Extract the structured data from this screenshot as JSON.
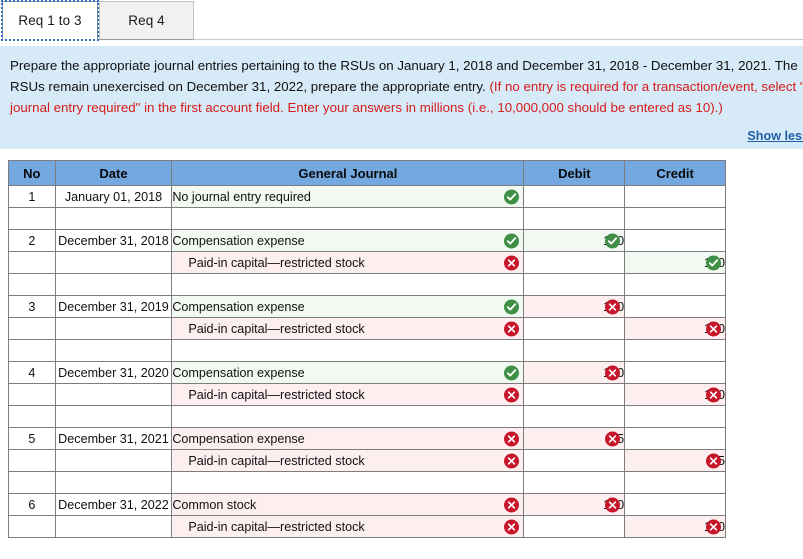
{
  "tabs": [
    {
      "label": "Req 1 to 3",
      "active": true
    },
    {
      "label": "Req 4",
      "active": false
    }
  ],
  "instructions": {
    "black_part_1": "Prepare the appropriate journal entries pertaining to the RSUs on January 1, 2018 and December 31, 2018 - December 31, 2021. The RSUs remain unexercised on December 31, 2022, prepare the appropriate entry. ",
    "red_part": "(If no entry is required for a transaction/event, select \"No journal entry required\" in the first account field. Enter your answers in millions (i.e., 10,000,000 should be entered as 10).)",
    "show_less_label": "Show less"
  },
  "table": {
    "headers": [
      "No",
      "Date",
      "General Journal",
      "Debit",
      "Credit"
    ],
    "rows": [
      {
        "no": "1",
        "date": "January 01, 2018",
        "account": "No journal entry required",
        "indent": false,
        "account_mark": "check",
        "debit": "",
        "debit_mark": "",
        "credit": "",
        "credit_mark": ""
      },
      {
        "no": "",
        "date": "",
        "account": "",
        "indent": true,
        "account_mark": "",
        "debit": "",
        "debit_mark": "",
        "credit": "",
        "credit_mark": ""
      },
      {
        "no": "2",
        "date": "December 31, 2018",
        "account": "Compensation expense",
        "indent": false,
        "account_mark": "check",
        "debit": "120",
        "debit_mark": "check",
        "credit": "",
        "credit_mark": ""
      },
      {
        "no": "",
        "date": "",
        "account": "Paid-in capital—restricted stock",
        "indent": true,
        "account_mark": "cross",
        "debit": "",
        "debit_mark": "",
        "credit": "120",
        "credit_mark": "check"
      },
      {
        "no": "",
        "date": "",
        "account": "",
        "indent": false,
        "account_mark": "",
        "debit": "",
        "debit_mark": "",
        "credit": "",
        "credit_mark": ""
      },
      {
        "no": "3",
        "date": "December 31, 2019",
        "account": "Compensation expense",
        "indent": false,
        "account_mark": "check",
        "debit": "180",
        "debit_mark": "cross",
        "credit": "",
        "credit_mark": ""
      },
      {
        "no": "",
        "date": "",
        "account": "Paid-in capital—restricted stock",
        "indent": true,
        "account_mark": "cross",
        "debit": "",
        "debit_mark": "",
        "credit": "180",
        "credit_mark": "cross"
      },
      {
        "no": "",
        "date": "",
        "account": "",
        "indent": false,
        "account_mark": "",
        "debit": "",
        "debit_mark": "",
        "credit": "",
        "credit_mark": ""
      },
      {
        "no": "4",
        "date": "December 31, 2020",
        "account": "Compensation expense",
        "indent": false,
        "account_mark": "check",
        "debit": "120",
        "debit_mark": "cross",
        "credit": "",
        "credit_mark": ""
      },
      {
        "no": "",
        "date": "",
        "account": "Paid-in capital—restricted stock",
        "indent": true,
        "account_mark": "cross",
        "debit": "",
        "debit_mark": "",
        "credit": "120",
        "credit_mark": "cross"
      },
      {
        "no": "",
        "date": "",
        "account": "",
        "indent": false,
        "account_mark": "",
        "debit": "",
        "debit_mark": "",
        "credit": "",
        "credit_mark": ""
      },
      {
        "no": "5",
        "date": "December 31, 2021",
        "account": "Compensation expense",
        "indent": false,
        "account_mark": "cross",
        "debit": "75",
        "debit_mark": "cross",
        "credit": "",
        "credit_mark": ""
      },
      {
        "no": "",
        "date": "",
        "account": "Paid-in capital—restricted stock",
        "indent": true,
        "account_mark": "cross",
        "debit": "",
        "debit_mark": "",
        "credit": "75",
        "credit_mark": "cross"
      },
      {
        "no": "",
        "date": "",
        "account": "",
        "indent": false,
        "account_mark": "",
        "debit": "",
        "debit_mark": "",
        "credit": "",
        "credit_mark": ""
      },
      {
        "no": "6",
        "date": "December 31, 2022",
        "account": "Common stock",
        "indent": false,
        "account_mark": "cross",
        "debit": "120",
        "debit_mark": "cross",
        "credit": "",
        "credit_mark": ""
      },
      {
        "no": "",
        "date": "",
        "account": "Paid-in capital—restricted stock",
        "indent": true,
        "account_mark": "cross",
        "debit": "",
        "debit_mark": "",
        "credit": "120",
        "credit_mark": "cross"
      }
    ]
  },
  "colors": {
    "header_blue": "#73a8e0",
    "panel_blue": "#d7eaf7",
    "red_text": "#d61b1b",
    "link_blue": "#1f5fa8",
    "mark_green": "#3f8f47",
    "mark_red": "#c6162a",
    "cell_green": "#f2f9f2",
    "cell_pink": "#fdeef0"
  }
}
